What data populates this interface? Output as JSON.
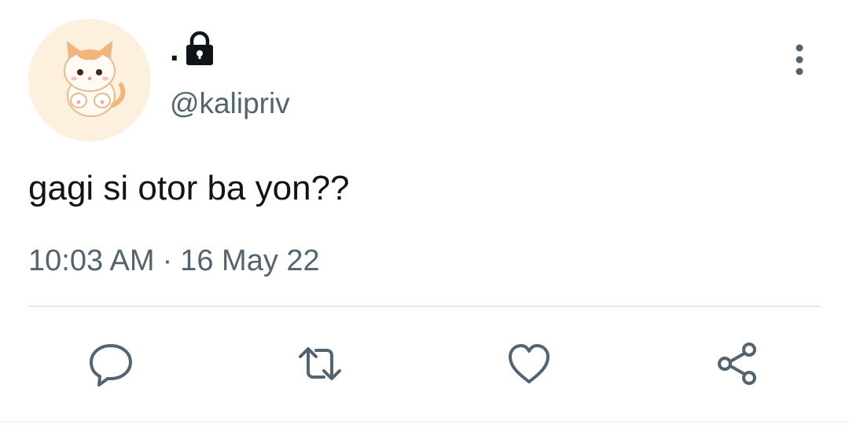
{
  "author": {
    "display_name": ".",
    "handle": "@kalipriv",
    "protected": true,
    "avatar": "kitten-illustration",
    "lock_icon": "lock-icon"
  },
  "tweet": {
    "text": "gagi si otor ba yon??",
    "time": "10:03 AM",
    "separator": "·",
    "date": "16 May 22"
  },
  "actions": [
    {
      "name": "reply",
      "icon": "reply-icon"
    },
    {
      "name": "retweet",
      "icon": "retweet-icon"
    },
    {
      "name": "like",
      "icon": "heart-icon"
    },
    {
      "name": "share",
      "icon": "share-icon"
    }
  ],
  "colors": {
    "text_primary": "#0f1419",
    "text_secondary": "#536471",
    "icon_gray": "#536471",
    "divider": "#e7eaec",
    "avatar_bg": "#fdf0de"
  }
}
